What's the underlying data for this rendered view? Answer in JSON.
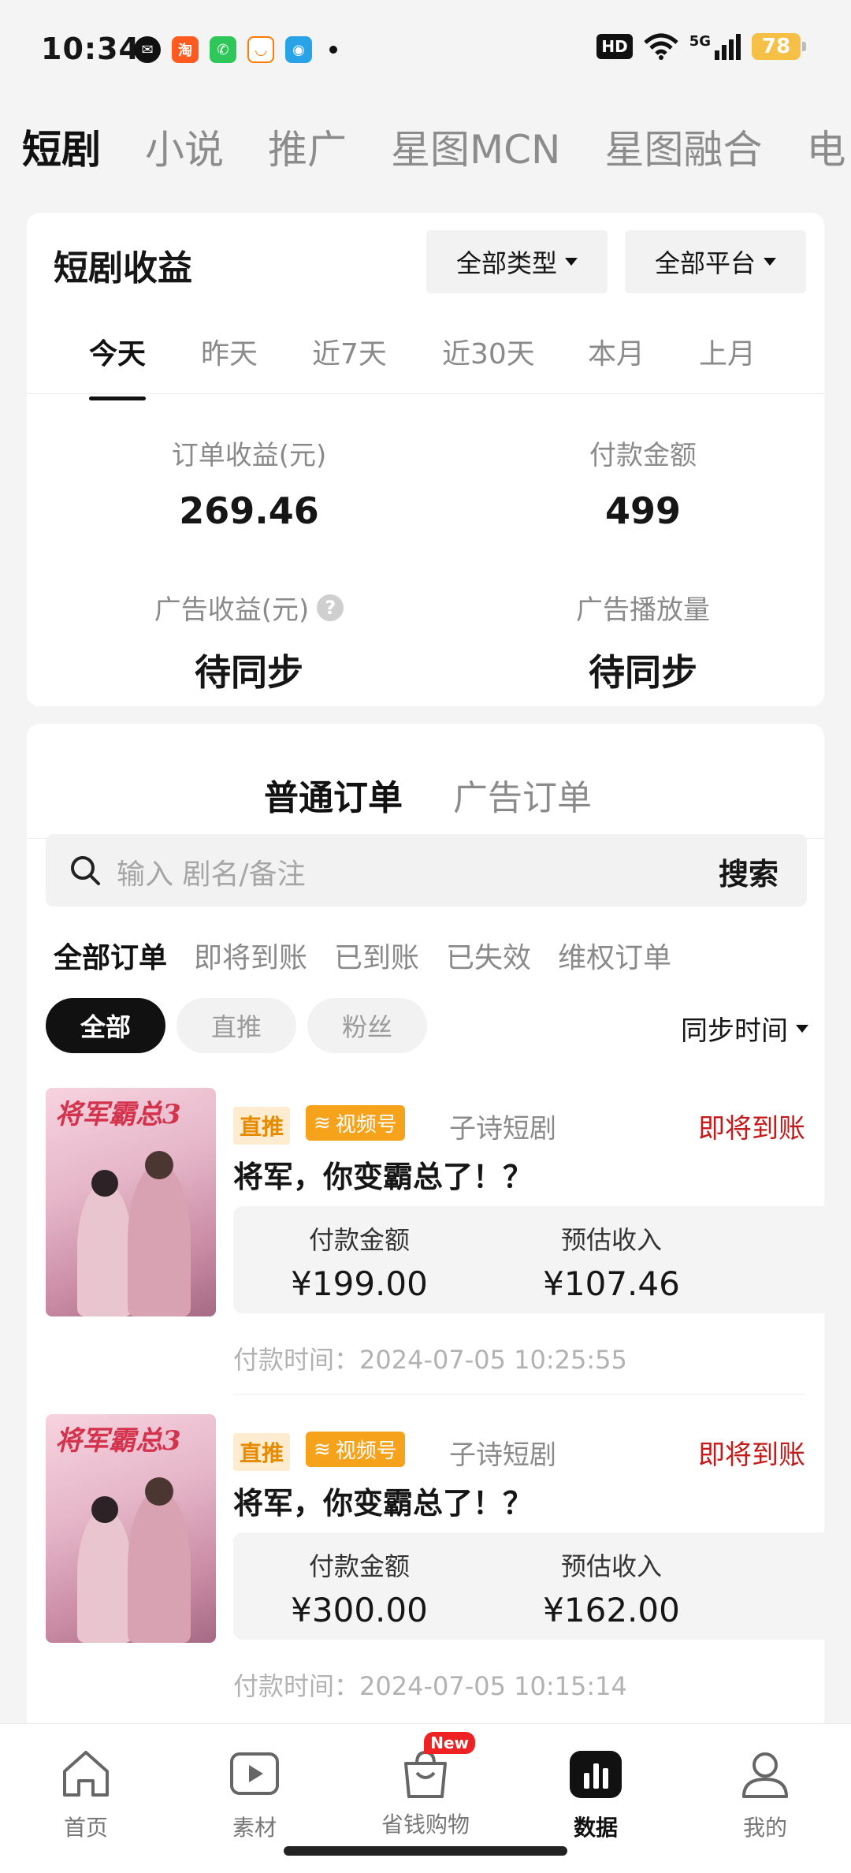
{
  "status_bar": {
    "time": "10:34",
    "hd": "HD",
    "network": "5G",
    "battery": "78"
  },
  "top_tabs": [
    "短剧",
    "小说",
    "推广",
    "星图MCN",
    "星图融合",
    "电"
  ],
  "earnings_card": {
    "title": "短剧收益",
    "type_filter": "全部类型",
    "platform_filter": "全部平台",
    "periods": [
      "今天",
      "昨天",
      "近7天",
      "近30天",
      "本月",
      "上月"
    ],
    "stats": {
      "order_income_label": "订单收益(元)",
      "order_income_value": "269.46",
      "paid_amount_label": "付款金额",
      "paid_amount_value": "499",
      "ad_income_label": "广告收益(元)",
      "ad_income_value": "待同步",
      "ad_plays_label": "广告播放量",
      "ad_plays_value": "待同步",
      "help_mark": "?"
    }
  },
  "orders_card": {
    "tabs": [
      "普通订单",
      "广告订单"
    ],
    "search_placeholder": "输入 剧名/备注",
    "search_button": "搜索",
    "status_tabs": [
      "全部订单",
      "即将到账",
      "已到账",
      "已失效",
      "维权订单"
    ],
    "chips": [
      "全部",
      "直推",
      "粉丝"
    ],
    "sort_label": "同步时间",
    "orders": [
      {
        "poster_title": "将军霸总3",
        "badge_direct": "直推",
        "badge_channel": "视频号",
        "vendor": "子诗短剧",
        "state": "即将到账",
        "title": "将军，你变霸总了！？",
        "paid_label": "付款金额",
        "paid_value": "¥199.00",
        "est_label": "预估收入",
        "est_value": "¥107.46",
        "pay_time": "付款时间：2024-07-05 10:25:55"
      },
      {
        "poster_title": "将军霸总3",
        "badge_direct": "直推",
        "badge_channel": "视频号",
        "vendor": "子诗短剧",
        "state": "即将到账",
        "title": "将军，你变霸总了！？",
        "paid_label": "付款金额",
        "paid_value": "¥300.00",
        "est_label": "预估收入",
        "est_value": "¥162.00",
        "pay_time": "付款时间：2024-07-05 10:15:14"
      }
    ]
  },
  "bottom_nav": {
    "items": [
      "首页",
      "素材",
      "省钱购物",
      "数据",
      "我的"
    ],
    "new_badge": "New"
  }
}
